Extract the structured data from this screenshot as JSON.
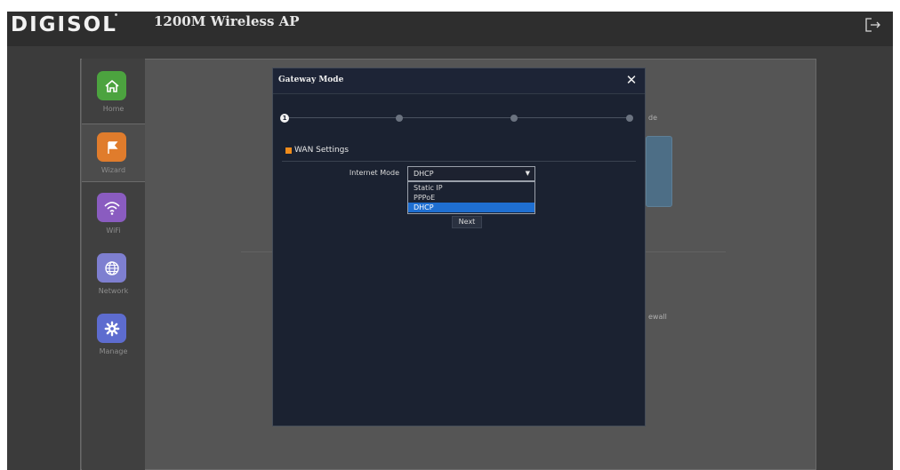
{
  "header": {
    "logo_text": "DIGISOL",
    "product_title": "1200M Wireless AP",
    "logout_icon": "logout-icon"
  },
  "sidebar": {
    "items": [
      {
        "label": "Home",
        "icon": "home-icon",
        "color": "#4ca33f",
        "active": false
      },
      {
        "label": "Wizard",
        "icon": "flag-icon",
        "color": "#e07c2c",
        "active": true
      },
      {
        "label": "WiFi",
        "icon": "wifi-icon",
        "color": "#8a5cc0",
        "active": false
      },
      {
        "label": "Network",
        "icon": "globe-icon",
        "color": "#7e7fd0",
        "active": false
      },
      {
        "label": "Manage",
        "icon": "gear-icon",
        "color": "#5d6ccf",
        "active": false
      }
    ]
  },
  "background": {
    "mode_text": "de",
    "firewall_text": "ewall"
  },
  "modal": {
    "title": "Gateway Mode",
    "close_label": "✕",
    "progress": {
      "steps": 4,
      "current": 1,
      "current_label": "1"
    },
    "section_title": "WAN Settings",
    "internet_mode": {
      "label": "Internet Mode",
      "value": "DHCP",
      "options": [
        "Static IP",
        "PPPoE",
        "DHCP"
      ],
      "selected_index": 2
    },
    "next_label": "Next"
  },
  "colors": {
    "accent": "#f08c1b",
    "selected_option": "#1f6fd1",
    "modal_bg": "#1b2231"
  }
}
